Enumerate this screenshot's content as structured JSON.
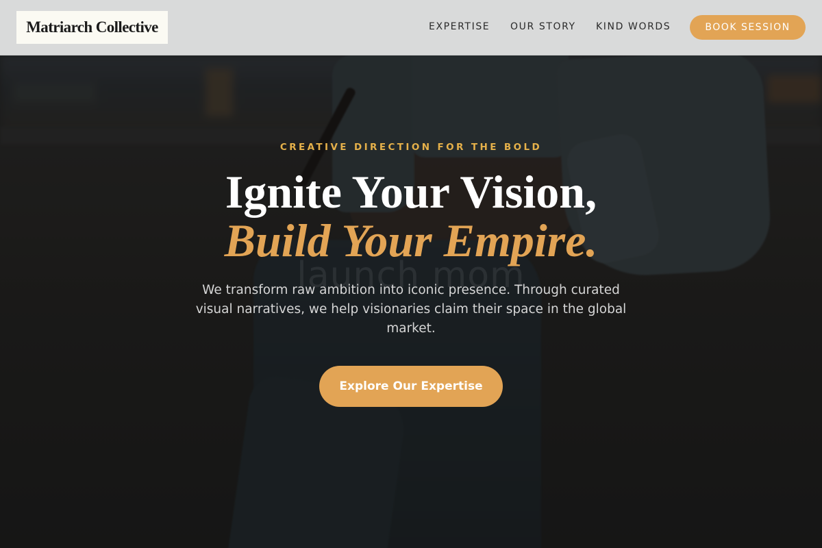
{
  "nav": {
    "logo": "Matriarch Collective",
    "links": [
      {
        "label": "EXPERTISE"
      },
      {
        "label": "OUR STORY"
      },
      {
        "label": "KIND WORDS"
      }
    ],
    "cta_label": "BOOK SESSION"
  },
  "hero": {
    "eyebrow": "CREATIVE DIRECTION FOR THE BOLD",
    "headline_line1": "Ignite Your Vision,",
    "headline_line2": "Build Your Empire.",
    "description": "We transform raw ambition into iconic presence. Through curated visual narratives, we help visionaries claim their space in the global market.",
    "cta_label": "Explore Our Expertise",
    "background_watermark": "launch mom"
  },
  "colors": {
    "accent": "#e2a455",
    "eyebrow": "#e6b14a",
    "nav_background": "#d9dada",
    "logo_background": "#fbfaf3"
  }
}
